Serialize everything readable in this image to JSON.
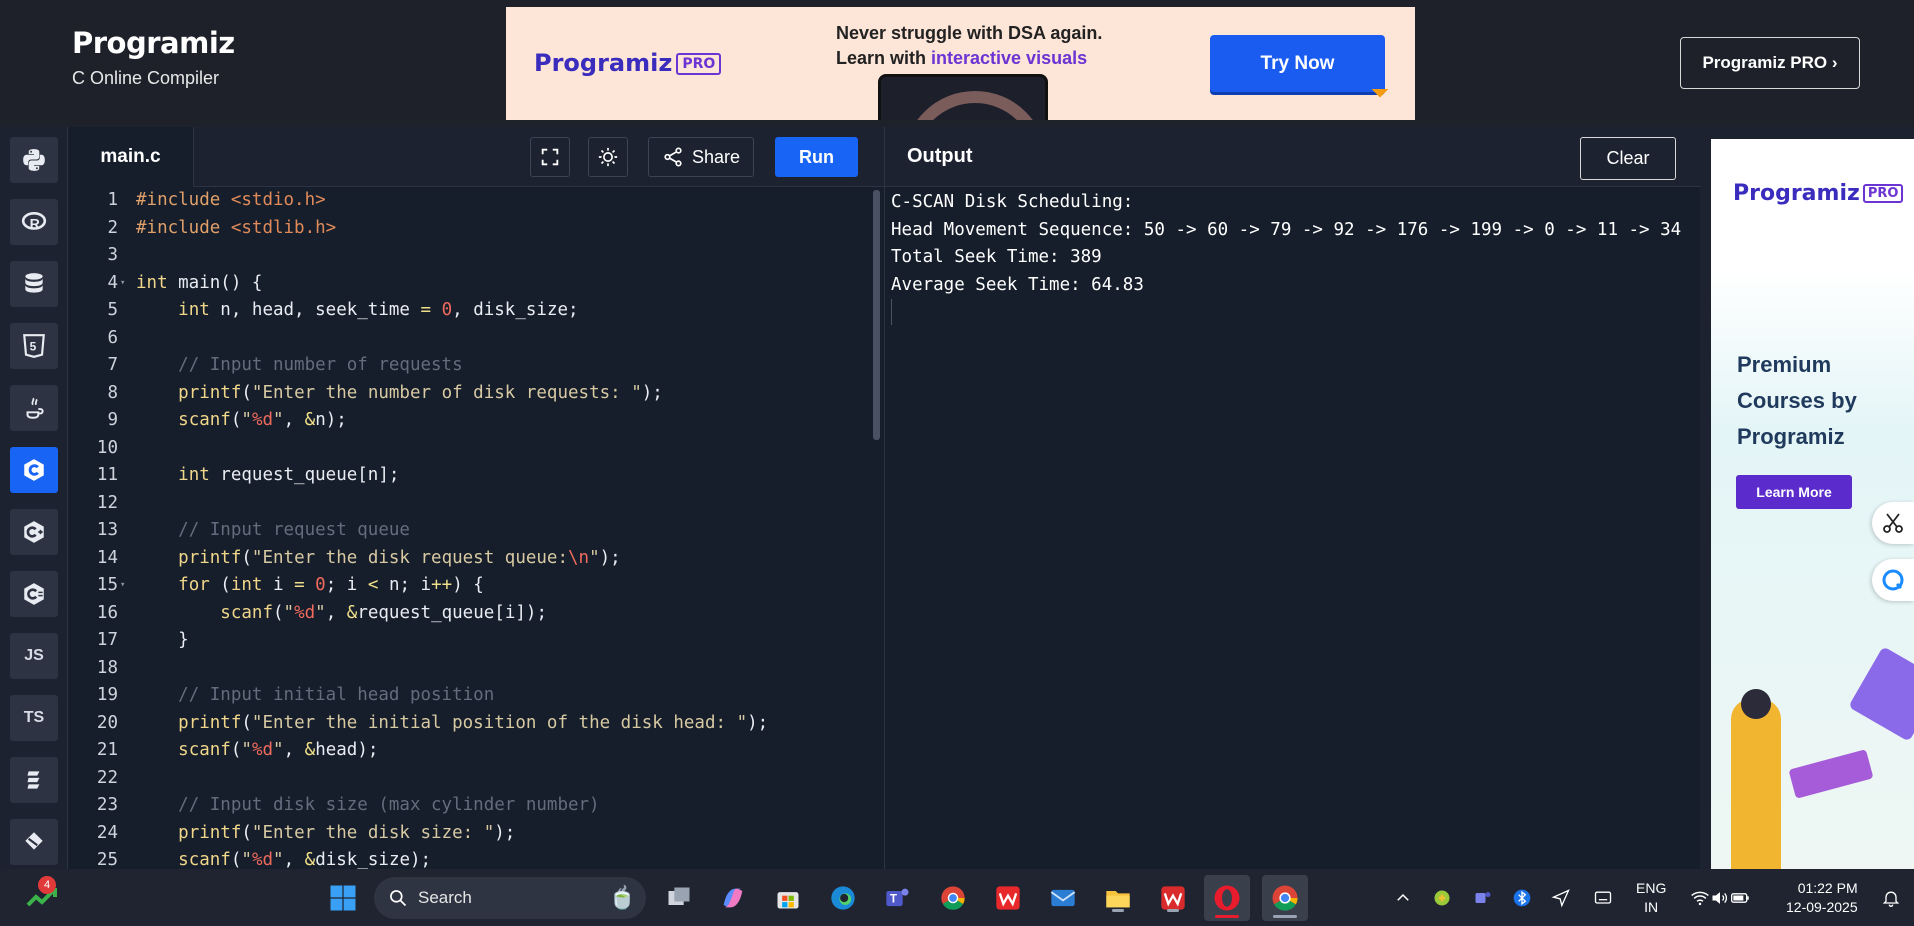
{
  "header": {
    "brand": "Programiz",
    "subtitle": "C Online Compiler",
    "pro_button": "Programiz PRO ›"
  },
  "ad_banner": {
    "logo": "Programiz",
    "logo_tag": "PRO",
    "line1": "Never struggle with DSA again.",
    "line2_prefix": "Learn with ",
    "line2_highlight": "interactive visuals",
    "cta": "Try Now"
  },
  "sidebar": {
    "items": [
      {
        "name": "python",
        "label": ""
      },
      {
        "name": "r",
        "label": "R"
      },
      {
        "name": "sql",
        "label": ""
      },
      {
        "name": "html",
        "label": "5"
      },
      {
        "name": "java",
        "label": ""
      },
      {
        "name": "c",
        "label": "C",
        "active": true
      },
      {
        "name": "cpp",
        "label": "C+"
      },
      {
        "name": "csharp",
        "label": "C#"
      },
      {
        "name": "js",
        "label": "JS"
      },
      {
        "name": "ts",
        "label": "TS"
      },
      {
        "name": "go",
        "label": ""
      },
      {
        "name": "swift",
        "label": ""
      }
    ]
  },
  "editor": {
    "filename": "main.c",
    "share_label": "Share",
    "run_label": "Run",
    "lines": [
      {
        "n": "1",
        "t": "#include <stdio.h>"
      },
      {
        "n": "2",
        "t": "#include <stdlib.h>"
      },
      {
        "n": "3",
        "t": ""
      },
      {
        "n": "4",
        "t": "int main() {",
        "fold": true
      },
      {
        "n": "5",
        "t": "    int n, head, seek_time = 0, disk_size;"
      },
      {
        "n": "6",
        "t": ""
      },
      {
        "n": "7",
        "t": "    // Input number of requests"
      },
      {
        "n": "8",
        "t": "    printf(\"Enter the number of disk requests: \");"
      },
      {
        "n": "9",
        "t": "    scanf(\"%d\", &n);"
      },
      {
        "n": "10",
        "t": ""
      },
      {
        "n": "11",
        "t": "    int request_queue[n];"
      },
      {
        "n": "12",
        "t": ""
      },
      {
        "n": "13",
        "t": "    // Input request queue"
      },
      {
        "n": "14",
        "t": "    printf(\"Enter the disk request queue:\\n\");"
      },
      {
        "n": "15",
        "t": "    for (int i = 0; i < n; i++) {",
        "fold": true
      },
      {
        "n": "16",
        "t": "        scanf(\"%d\", &request_queue[i]);"
      },
      {
        "n": "17",
        "t": "    }"
      },
      {
        "n": "18",
        "t": ""
      },
      {
        "n": "19",
        "t": "    // Input initial head position"
      },
      {
        "n": "20",
        "t": "    printf(\"Enter the initial position of the disk head: \");"
      },
      {
        "n": "21",
        "t": "    scanf(\"%d\", &head);"
      },
      {
        "n": "22",
        "t": ""
      },
      {
        "n": "23",
        "t": "    // Input disk size (max cylinder number)"
      },
      {
        "n": "24",
        "t": "    printf(\"Enter the disk size: \");"
      },
      {
        "n": "25",
        "t": "    scanf(\"%d\", &disk_size);"
      }
    ]
  },
  "output": {
    "title": "Output",
    "clear_label": "Clear",
    "lines": [
      "C-SCAN Disk Scheduling:",
      "Head Movement Sequence: 50 -> 60 -> 79 -> 92 -> 176 -> 199 -> 0 -> 11 -> 34",
      "Total Seek Time: 389",
      "Average Seek Time: 64.83"
    ]
  },
  "right_ad": {
    "logo": "Programiz",
    "logo_tag": "PRO",
    "heading_lines": [
      "Premium",
      "Courses by",
      "Programiz"
    ],
    "button": "Learn More"
  },
  "taskbar": {
    "badge_count": "4",
    "search_placeholder": "Search",
    "lang_line1": "ENG",
    "lang_line2": "IN",
    "time": "01:22 PM",
    "date": "12-09-2025"
  },
  "colors": {
    "accent": "#1764f5",
    "background": "#161e2b",
    "header": "#1e2129"
  }
}
